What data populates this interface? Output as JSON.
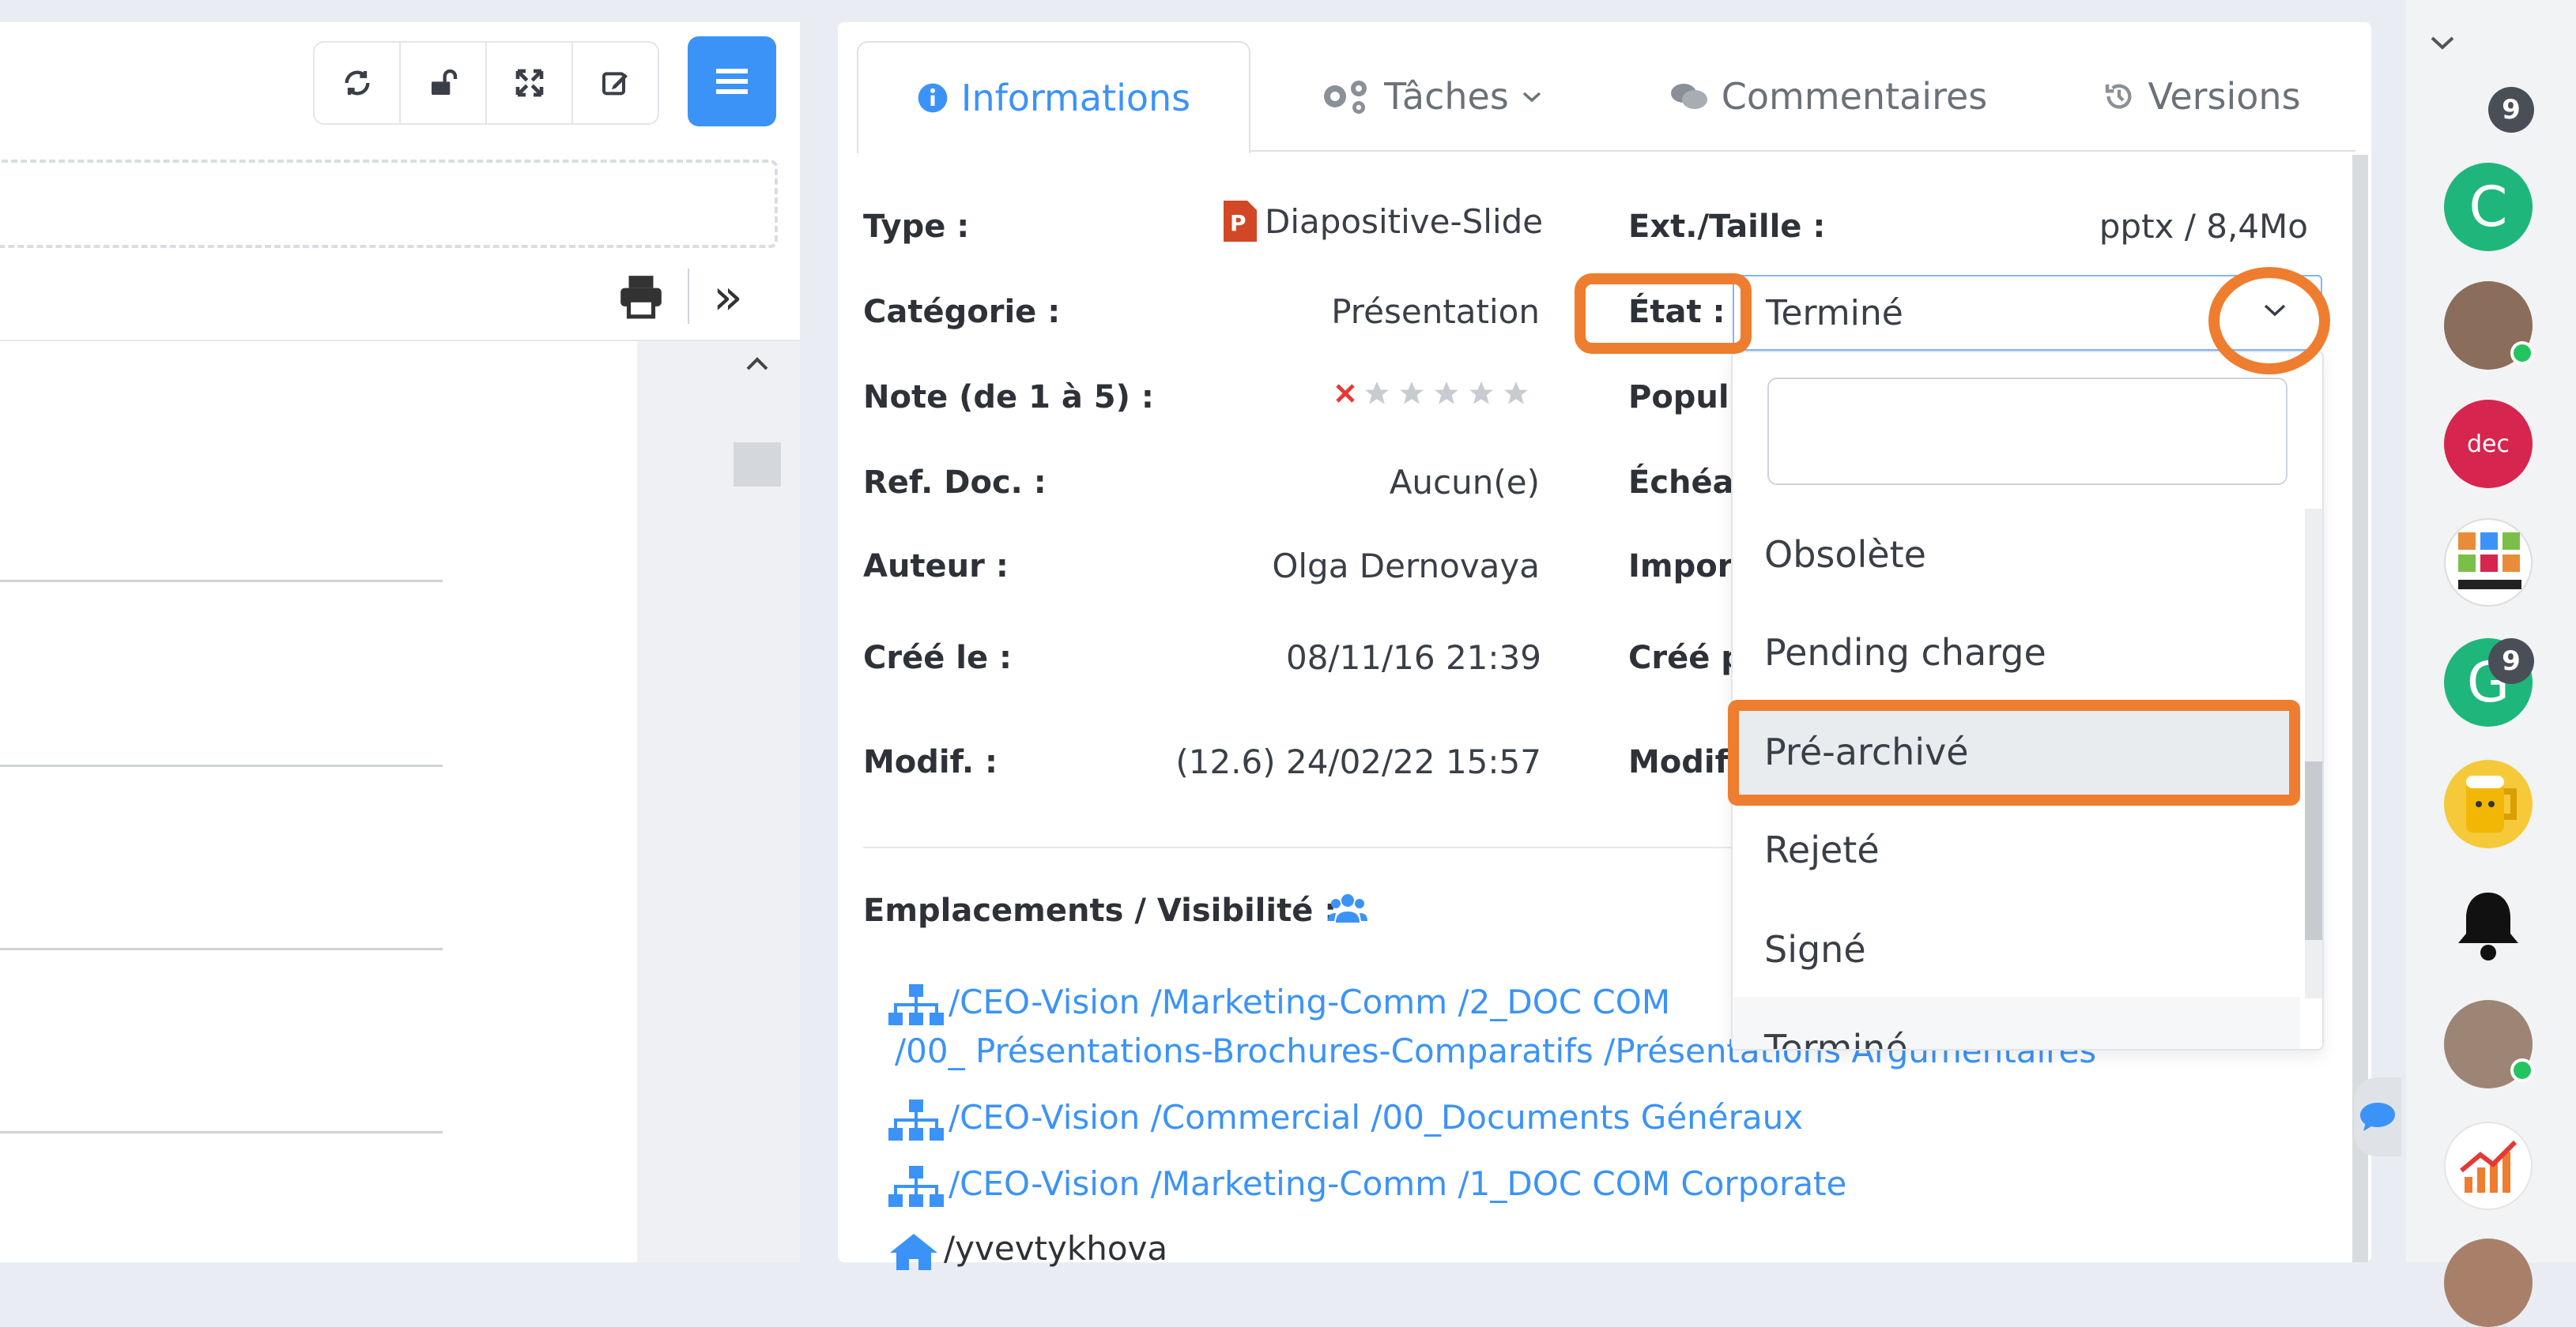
{
  "toolbar": {
    "buttons": [
      "refresh-icon",
      "unlock-icon",
      "fullscreen-icon",
      "edit-icon"
    ],
    "menu_icon": "hamburger-icon"
  },
  "viewer": {
    "print_icon": "print-icon",
    "expand_glyph": "»"
  },
  "tabs": [
    {
      "label": "Informations",
      "icon": "info-circle-icon",
      "active": true
    },
    {
      "label": "Tâches",
      "icon": "gears-icon"
    },
    {
      "label": "Commentaires",
      "icon": "comments-icon"
    },
    {
      "label": "Versions",
      "icon": "history-icon"
    }
  ],
  "info": {
    "type_label": "Type :",
    "type_value": "Diapositive-Slide",
    "categorie_label": "Catégorie :",
    "categorie_value": "Présentation",
    "note_label": "Note (de 1 à 5) :",
    "note_value": 0,
    "ref_label": "Ref. Doc. :",
    "ref_value": "Aucun(e)",
    "auteur_label": "Auteur :",
    "auteur_value": "Olga Dernovaya",
    "cree_label": "Créé le :",
    "cree_value": "08/11/16 21:39",
    "modif_label": "Modif. :",
    "modif_value": "(12.6) 24/02/22 15:57",
    "ext_label": "Ext./Taille :",
    "ext_value": "pptx / 8,4Mo",
    "etat_label": "État :",
    "etat_value": "Terminé",
    "popul_label": "Popul",
    "echea_label": "Échéa",
    "impor_label": "Impor",
    "creep_label": "Créé p",
    "modif2_label": "Modif."
  },
  "dropdown": {
    "search_placeholder": "",
    "options": [
      "Obsolète",
      "Pending charge",
      "Pré-archivé",
      "Rejeté",
      "Signé",
      "Terminé"
    ],
    "highlighted": "Pré-archivé"
  },
  "locations": {
    "title": "Emplacements / Visibilité :",
    "paths": [
      {
        "segments": [
          "/CEO-Vision",
          "/Marketing-Comm",
          "/2_DOC COM"
        ]
      },
      {
        "segments": [
          "/00_ Présentations-Brochures-Comparatifs",
          "/Présentations Argumentaires"
        ]
      },
      {
        "segments": [
          "/CEO-Vision",
          "/Commercial",
          "/00_Documents Généraux"
        ]
      },
      {
        "segments": [
          "/CEO-Vision",
          "/Marketing-Comm",
          "/1_DOC COM Corporate"
        ]
      },
      {
        "segments": [
          "/yvevtykhova"
        ]
      }
    ]
  },
  "sidebar": {
    "collapse_glyph": "⌄",
    "top_badge": "9",
    "avatars": [
      {
        "letter": "C",
        "color": "#1fb67c"
      },
      {
        "letter": "",
        "color": "#8a6d5a",
        "online": true
      },
      {
        "letter": "dec",
        "color": "#d6254e"
      },
      {
        "letter": "",
        "color": "#ffffff"
      },
      {
        "letter": "G",
        "color": "#1fb67c",
        "badge": "9"
      },
      {
        "letter": "",
        "color": "#f5c93a"
      },
      {
        "letter": "",
        "color": "#111111"
      },
      {
        "letter": "",
        "color": "#9c8574",
        "online": true
      },
      {
        "letter": "",
        "color": "#ffffff"
      }
    ]
  },
  "colors": {
    "accent": "#3b93f7",
    "highlight": "#ee7d2f",
    "star_empty": "#c8ccd1",
    "clear_x": "#e53935"
  }
}
